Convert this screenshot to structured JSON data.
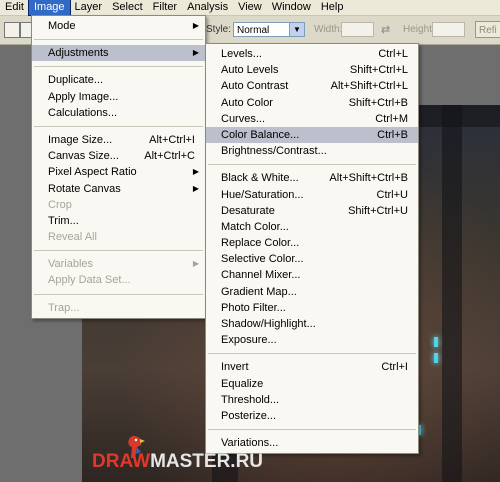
{
  "menubar": [
    "Edit",
    "Image",
    "Layer",
    "Select",
    "Filter",
    "Analysis",
    "View",
    "Window",
    "Help"
  ],
  "options": {
    "style_label": "Style:",
    "style_value": "Normal",
    "width_label": "Width:",
    "height_label": "Height:",
    "refine": "Refi"
  },
  "image_menu": [
    {
      "label": "Mode",
      "sub": true
    },
    {
      "sep": true
    },
    {
      "label": "Adjustments",
      "sub": true,
      "highlight": true
    },
    {
      "sep": true
    },
    {
      "label": "Duplicate..."
    },
    {
      "label": "Apply Image..."
    },
    {
      "label": "Calculations..."
    },
    {
      "sep": true
    },
    {
      "label": "Image Size...",
      "shortcut": "Alt+Ctrl+I"
    },
    {
      "label": "Canvas Size...",
      "shortcut": "Alt+Ctrl+C"
    },
    {
      "label": "Pixel Aspect Ratio",
      "sub": true
    },
    {
      "label": "Rotate Canvas",
      "sub": true
    },
    {
      "label": "Crop",
      "disabled": true
    },
    {
      "label": "Trim..."
    },
    {
      "label": "Reveal All",
      "disabled": true
    },
    {
      "sep": true
    },
    {
      "label": "Variables",
      "sub": true,
      "disabled": true
    },
    {
      "label": "Apply Data Set...",
      "disabled": true
    },
    {
      "sep": true
    },
    {
      "label": "Trap...",
      "disabled": true
    }
  ],
  "adjust_menu": [
    {
      "label": "Levels...",
      "shortcut": "Ctrl+L"
    },
    {
      "label": "Auto Levels",
      "shortcut": "Shift+Ctrl+L"
    },
    {
      "label": "Auto Contrast",
      "shortcut": "Alt+Shift+Ctrl+L"
    },
    {
      "label": "Auto Color",
      "shortcut": "Shift+Ctrl+B"
    },
    {
      "label": "Curves...",
      "shortcut": "Ctrl+M"
    },
    {
      "label": "Color Balance...",
      "shortcut": "Ctrl+B",
      "highlight": true
    },
    {
      "label": "Brightness/Contrast..."
    },
    {
      "sep": true
    },
    {
      "label": "Black & White...",
      "shortcut": "Alt+Shift+Ctrl+B"
    },
    {
      "label": "Hue/Saturation...",
      "shortcut": "Ctrl+U"
    },
    {
      "label": "Desaturate",
      "shortcut": "Shift+Ctrl+U"
    },
    {
      "label": "Match Color..."
    },
    {
      "label": "Replace Color..."
    },
    {
      "label": "Selective Color..."
    },
    {
      "label": "Channel Mixer..."
    },
    {
      "label": "Gradient Map..."
    },
    {
      "label": "Photo Filter..."
    },
    {
      "label": "Shadow/Highlight..."
    },
    {
      "label": "Exposure..."
    },
    {
      "sep": true
    },
    {
      "label": "Invert",
      "shortcut": "Ctrl+I"
    },
    {
      "label": "Equalize"
    },
    {
      "label": "Threshold..."
    },
    {
      "label": "Posterize..."
    },
    {
      "sep": true
    },
    {
      "label": "Variations..."
    }
  ],
  "watermark": {
    "part1": "DRAW",
    "part2": "MASTER.RU"
  },
  "colors": {
    "highlight_bg": "#bcc0cc",
    "active_menu": "#316ac5"
  }
}
